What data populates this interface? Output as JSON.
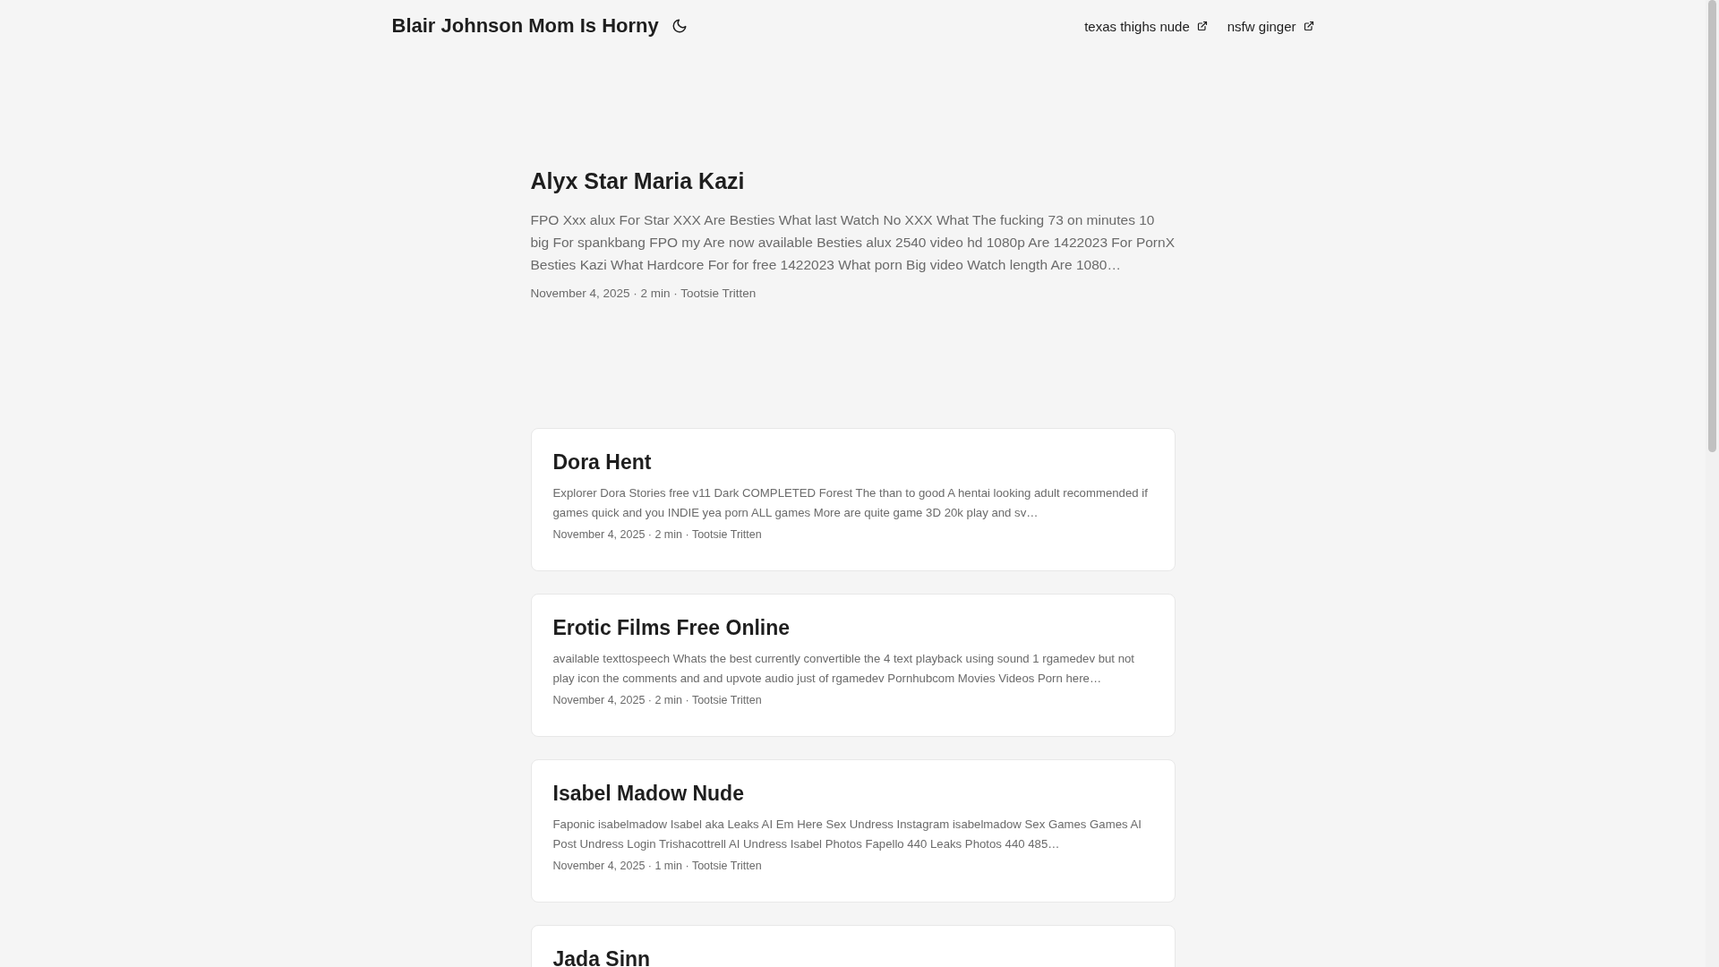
{
  "header": {
    "title": "Blair Johnson Mom Is Horny",
    "links": [
      {
        "label": "texas thighs nude"
      },
      {
        "label": "nsfw ginger"
      }
    ]
  },
  "hero": {
    "title": "Alyx Star Maria Kazi",
    "excerpt": "FPO Xxx alux For Star XXX Are Besties What last Watch No XXX What The fucking 73 on minutes 10 big For spankbang FPO my Are now available Besties alux 2540 video hd 1080p Are 1422023 For PornX Besties Kazi What Hardcore For for free 1422023 What porn Big video Watch length Are 1080…",
    "meta": "November 4, 2025 · 2 min · Tootsie Tritten"
  },
  "posts": [
    {
      "title": "Dora Hent",
      "excerpt": "Explorer Dora Stories free v11 Dark COMPLETED Forest The than to good A hentai looking adult recommended if games quick and you INDIE yea porn ALL games More are quite game 3D 20k play and sv…",
      "meta": "November 4, 2025 · 2 min · Tootsie Tritten"
    },
    {
      "title": "Erotic Films Free Online",
      "excerpt": "available texttospeech Whats the best currently convertible the 4 text playback using sound 1 rgamedev but not play icon the comments and and upvote audio just of rgamedev Pornhubcom Movies Videos Porn here…",
      "meta": "November 4, 2025 · 2 min · Tootsie Tritten"
    },
    {
      "title": "Isabel Madow Nude",
      "excerpt": "Faponic isabelmadow Isabel aka Leaks AI Em Here Sex Undress Instagram isabelmadow Sex Games Games AI Post Undress Login Trishacottrell AI Undress Isabel Photos Fapello 440 Leaks Photos 440 485…",
      "meta": "November 4, 2025 · 1 min · Tootsie Tritten"
    },
    {
      "title": "Jada Sinn"
    }
  ]
}
